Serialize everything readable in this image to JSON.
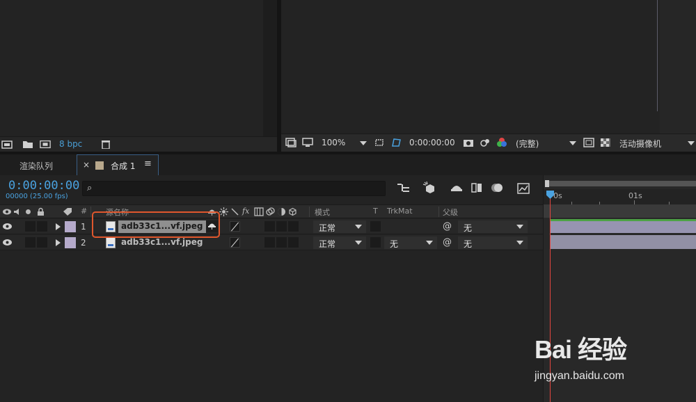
{
  "project_panel": {
    "bit_depth": "8 bpc"
  },
  "comp_viewer": {
    "zoom": "100%",
    "timecode": "0:00:00:00",
    "resolution": "(完整)",
    "camera": "活动摄像机"
  },
  "tabs": [
    {
      "label": "渲染队列"
    },
    {
      "label": "合成 1",
      "close": "×",
      "menu": "≡"
    }
  ],
  "timeline": {
    "timecode": "0:00:00:00",
    "frame_info": "00000 (25.00 fps)",
    "search_icon": "⌕",
    "columns": {
      "hash": "#",
      "source_name": "源名称",
      "mode": "模式",
      "t": "T",
      "trkmat": "TrkMat",
      "parent": "父级"
    },
    "ruler": {
      "start": "0s",
      "mark": "01s"
    },
    "layers": [
      {
        "number": "1",
        "name": "adb33c1...vf.jpeg",
        "mode": "正常",
        "trkmat": "",
        "parent": "无",
        "selected": true
      },
      {
        "number": "2",
        "name": "adb33c1...vf.jpeg",
        "mode": "正常",
        "trkmat": "无",
        "parent": "无",
        "selected": false
      }
    ]
  },
  "watermark": {
    "logo_text": "Bai 经验",
    "url": "jingyan.baidu.com"
  },
  "colors": {
    "accent": "#4aa2e0",
    "highlight": "#e0572d",
    "layer_label": "#b5aacb",
    "playhead": "#e4463f"
  }
}
